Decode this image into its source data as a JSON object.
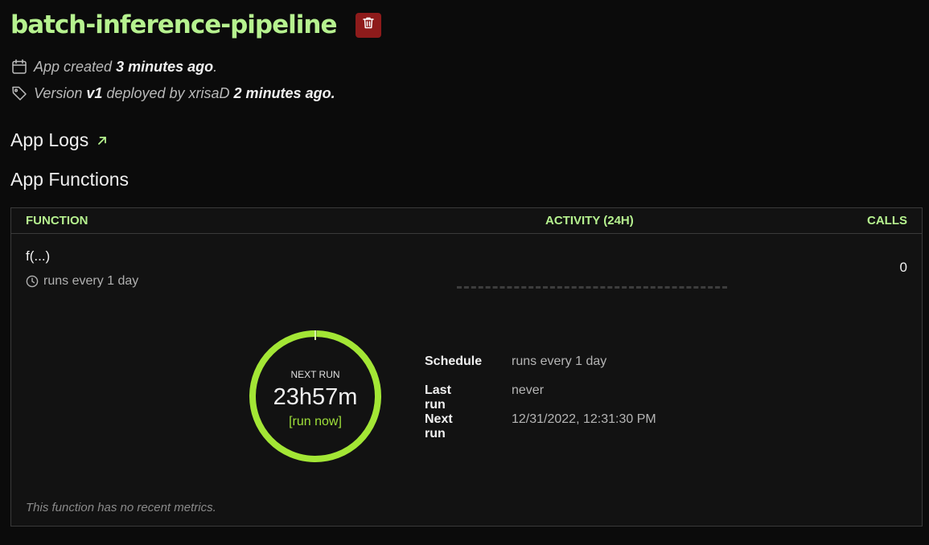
{
  "app": {
    "title": "batch-inference-pipeline",
    "delete_icon": "trash-icon"
  },
  "meta": {
    "created_prefix": "App created",
    "created_value": "3 minutes ago",
    "created_suffix": ".",
    "version_prefix": "Version",
    "version_value": "v1",
    "version_mid": "deployed by xrisaD",
    "deployed_value": "2 minutes ago."
  },
  "sections": {
    "logs_label": "App Logs",
    "functions_label": "App Functions"
  },
  "table": {
    "headers": {
      "function": "FUNCTION",
      "activity": "ACTIVITY (24H)",
      "calls": "CALLS"
    },
    "row": {
      "name": "f(...)",
      "schedule": "runs every 1 day",
      "calls": "0"
    },
    "next_run": {
      "label": "NEXT RUN",
      "time": "23h57m",
      "run_now": "[run now]",
      "progress_fraction": 0.998
    },
    "details": [
      {
        "key": "Schedule",
        "value": "runs every 1 day"
      },
      {
        "key": "Last run",
        "value": "never"
      },
      {
        "key": "Next run",
        "value": "12/31/2022, 12:31:30 PM"
      }
    ],
    "empty_note": "This function has no recent metrics."
  },
  "colors": {
    "accent": "#b6f28f",
    "ring": "#a3e635",
    "danger": "#8e1b1b"
  }
}
